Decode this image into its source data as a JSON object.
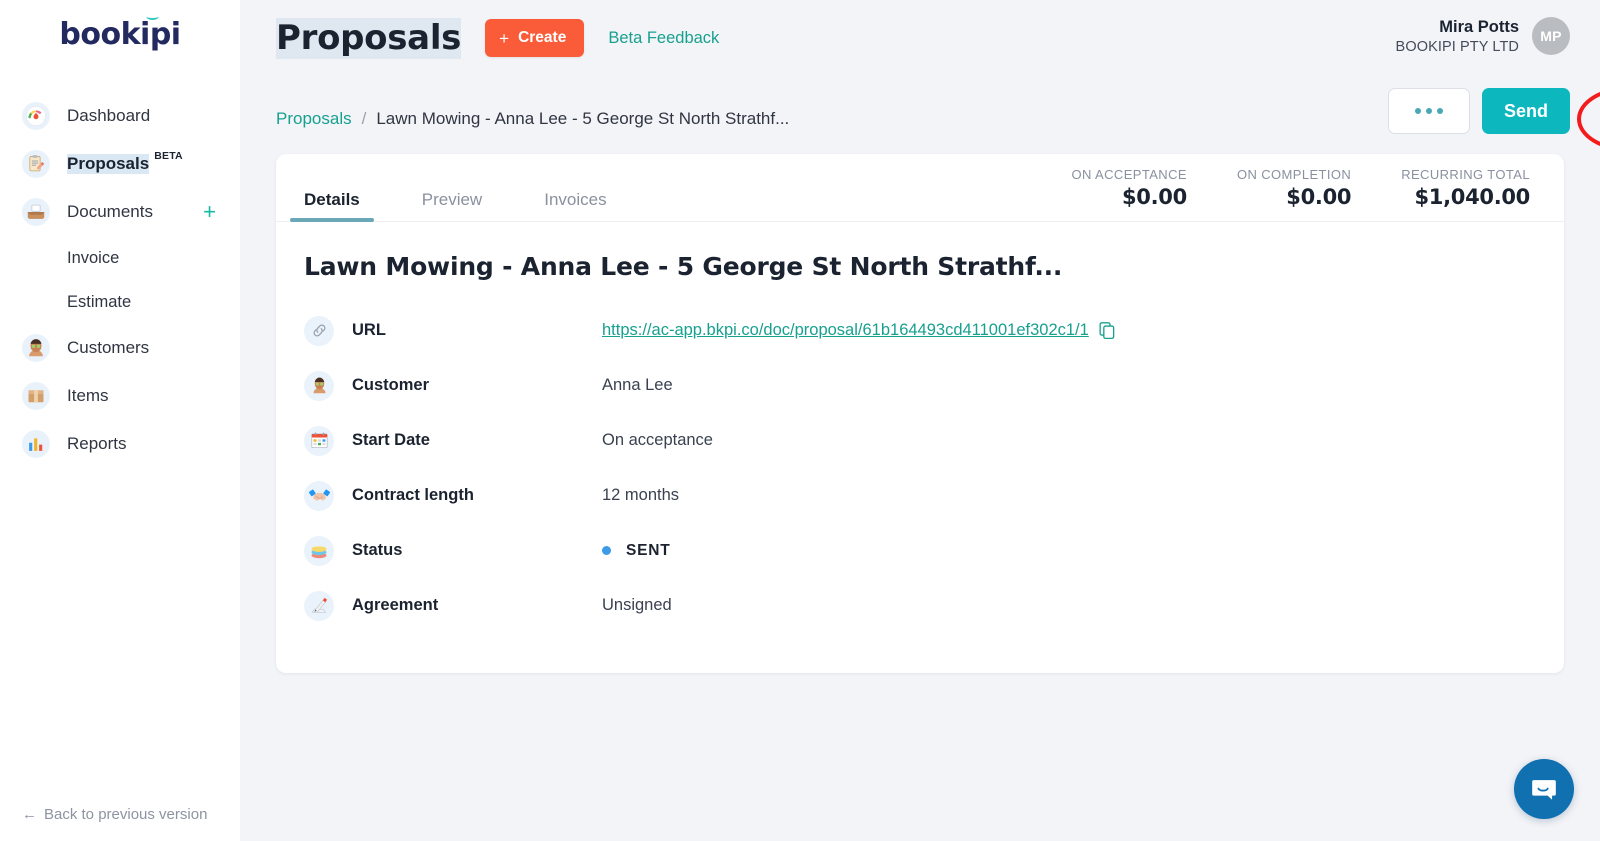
{
  "brand": {
    "logo_text": "bookipi",
    "logo_color": "#222a5f",
    "accent_teal": "#18a08f"
  },
  "sidebar": {
    "items": [
      {
        "label": "Dashboard",
        "icon": "dashboard-gauge-icon",
        "glyph": "🔥"
      },
      {
        "label": "Proposals",
        "icon": "proposal-clipboard-icon",
        "glyph": "📋",
        "badge": "BETA",
        "active": true
      },
      {
        "label": "Documents",
        "icon": "documents-tray-icon",
        "glyph": "🗃",
        "plus": "+"
      },
      {
        "label": "Invoice",
        "icon": "invoice-subitem-icon",
        "sub": true
      },
      {
        "label": "Estimate",
        "icon": "estimate-subitem-icon",
        "sub": true
      },
      {
        "label": "Customers",
        "icon": "customers-person-icon",
        "glyph": "🧑"
      },
      {
        "label": "Items",
        "icon": "items-box-icon",
        "glyph": "📦"
      },
      {
        "label": "Reports",
        "icon": "reports-chart-icon",
        "glyph": "📊"
      }
    ],
    "footer_label": "Back to previous version",
    "footer_arrow": "←"
  },
  "header": {
    "page_title": "Proposals",
    "create_label": "Create",
    "create_plus": "+",
    "beta_feedback_label": "Beta Feedback",
    "user_name": "Mira Potts",
    "user_company": "BOOKIPI PTY LTD",
    "avatar_initials": "MP"
  },
  "breadcrumb": {
    "parent": "Proposals",
    "separator": "/",
    "current": "Lawn Mowing - Anna Lee - 5 George St North Strathf..."
  },
  "actions": {
    "more_label": "•••",
    "send_label": "Send"
  },
  "card": {
    "tabs": [
      {
        "label": "Details",
        "active": true
      },
      {
        "label": "Preview",
        "active": false
      },
      {
        "label": "Invoices",
        "active": false
      }
    ],
    "totals": [
      {
        "label": "ON ACCEPTANCE",
        "value": "$0.00"
      },
      {
        "label": "ON COMPLETION",
        "value": "$0.00"
      },
      {
        "label": "RECURRING TOTAL",
        "value": "$1,040.00"
      }
    ],
    "doc_title": "Lawn Mowing - Anna Lee - 5 George St North Strathf...",
    "details": [
      {
        "label": "URL",
        "value": "https://ac-app.bkpi.co/doc/proposal/61b164493cd411001ef302c1/1",
        "icon": "link-icon",
        "glyph": "🔗",
        "type": "link"
      },
      {
        "label": "Customer",
        "value": "Anna Lee",
        "icon": "person-icon",
        "glyph": "🧑",
        "type": "text"
      },
      {
        "label": "Start Date",
        "value": "On acceptance",
        "icon": "calendar-icon",
        "glyph": "📅",
        "type": "text"
      },
      {
        "label": "Contract length",
        "value": "12 months",
        "icon": "handshake-icon",
        "glyph": "🤝",
        "type": "text"
      },
      {
        "label": "Status",
        "value": "SENT",
        "icon": "layers-icon",
        "glyph": "📚",
        "type": "status",
        "status_color": "#3c9ae8"
      },
      {
        "label": "Agreement",
        "value": "Unsigned",
        "icon": "signature-pen-icon",
        "glyph": "🖋",
        "type": "text"
      }
    ]
  },
  "chat": {
    "name": "intercom-launcher"
  },
  "annotation": {
    "shape": "ellipse",
    "color": "#f31b1b",
    "target": "more-options-button"
  }
}
